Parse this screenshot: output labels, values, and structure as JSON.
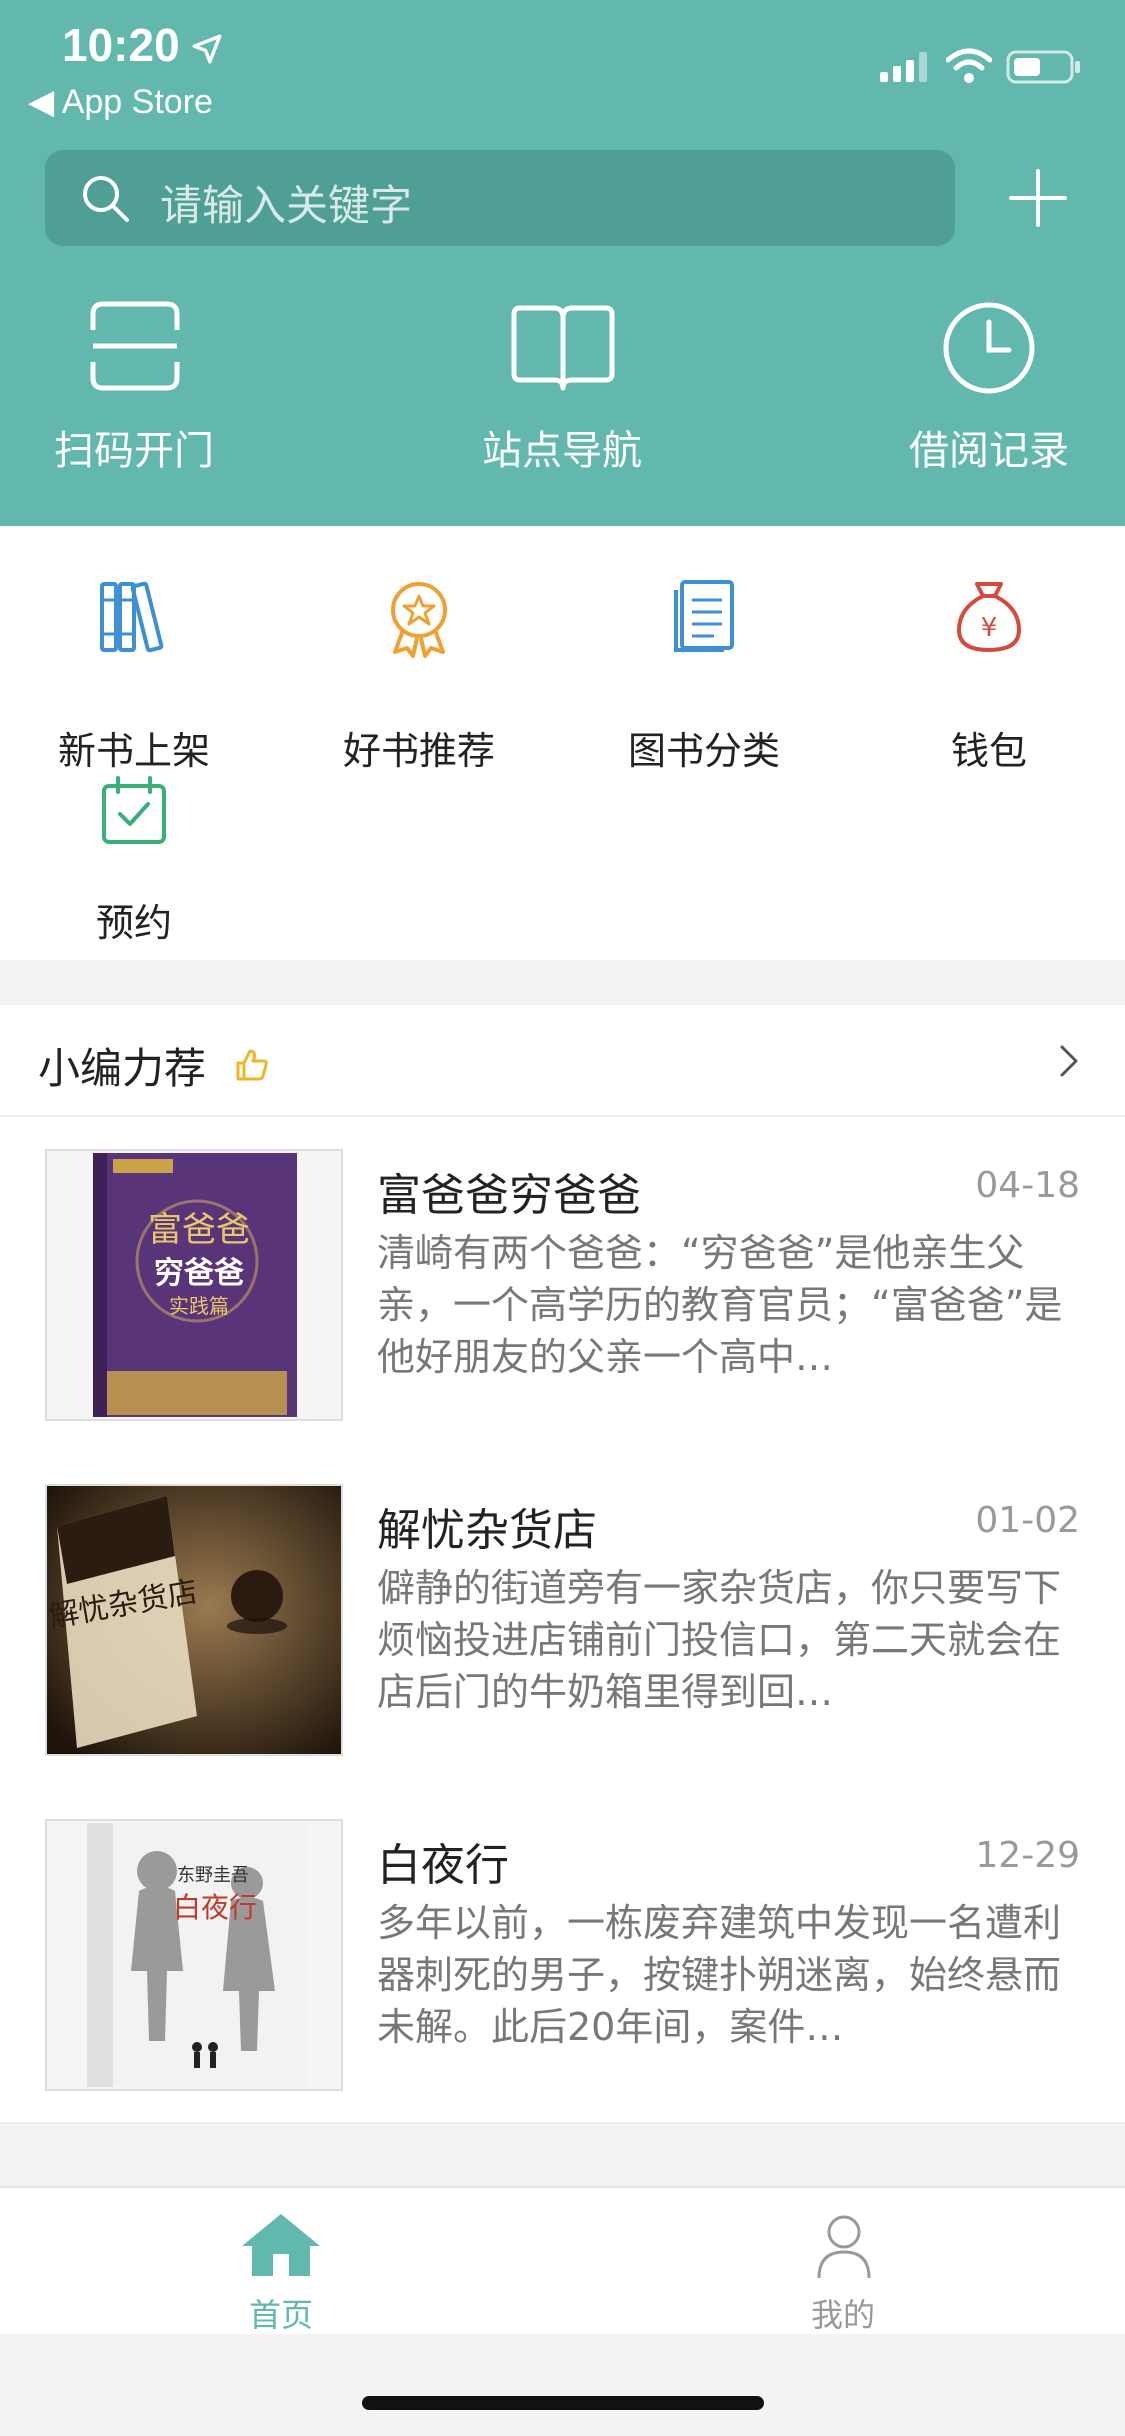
{
  "status": {
    "time": "10:20",
    "back_label": "◀ App Store"
  },
  "search": {
    "placeholder": "请输入关键字"
  },
  "top_actions": [
    {
      "label": "扫码开门",
      "icon": "scan-icon"
    },
    {
      "label": "站点导航",
      "icon": "book-open-icon"
    },
    {
      "label": "借阅记录",
      "icon": "clock-icon"
    }
  ],
  "categories": [
    {
      "label": "新书上架",
      "icon": "bookshelf-icon",
      "color": "#3d8fd6"
    },
    {
      "label": "好书推荐",
      "icon": "award-icon",
      "color": "#f0a030"
    },
    {
      "label": "图书分类",
      "icon": "document-icon",
      "color": "#3d8fd6"
    },
    {
      "label": "钱包",
      "icon": "money-bag-icon",
      "color": "#d64a3d"
    },
    {
      "label": "预约",
      "icon": "calendar-check-icon",
      "color": "#38b07a"
    }
  ],
  "section": {
    "title": "小编力荐"
  },
  "books": [
    {
      "title": "富爸爸穷爸爸",
      "date": "04-18",
      "desc": "清崎有两个爸爸：“穷爸爸”是他亲生父亲，一个高学历的教育官员；“富爸爸”是他好朋友的父亲一个高中…",
      "cover_title": "富爸爸",
      "cover_sub": "穷爸爸",
      "cover_sub2": "实践篇"
    },
    {
      "title": "解忧杂货店",
      "date": "01-02",
      "desc": "僻静的街道旁有一家杂货店，你只要写下烦恼投进店铺前门投信口，第二天就会在店后门的牛奶箱里得到回…",
      "cover_title": "解忧杂货店"
    },
    {
      "title": "白夜行",
      "date": "12-29",
      "desc": "多年以前，一栋废弃建筑中发现一名遭利器刺死的男子，按键扑朔迷离，始终悬而未解。此后20年间，案件…",
      "cover_author": "东野圭吾",
      "cover_title": "白夜行"
    }
  ],
  "tabs": [
    {
      "label": "首页",
      "active": true
    },
    {
      "label": "我的",
      "active": false
    }
  ],
  "colors": {
    "primary": "#62b8ad",
    "search_bg": "#4f9f95"
  }
}
